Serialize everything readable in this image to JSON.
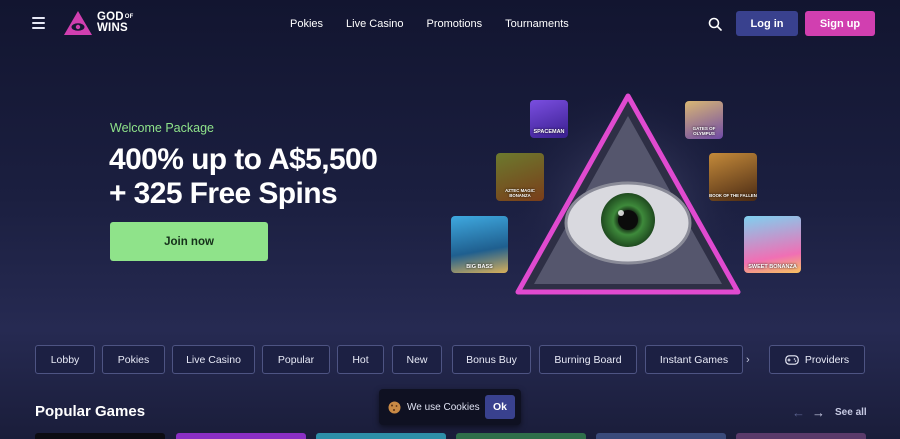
{
  "brand": {
    "logo_text_line1": "GOD",
    "logo_text_of": "OF",
    "logo_text_line2": "WINS",
    "accent_pink": "#d13fb0",
    "accent_green": "#8fe38a",
    "login_blue": "#39418e"
  },
  "header": {
    "nav": [
      "Pokies",
      "Live Casino",
      "Promotions",
      "Tournaments"
    ],
    "login_label": "Log in",
    "signup_label": "Sign up"
  },
  "hero": {
    "eyebrow": "Welcome Package",
    "headline_line1": "400% up to A$5,500",
    "headline_line2": "+ 325 Free Spins",
    "cta_label": "Join now",
    "games": [
      "SPACEMAN",
      "GATES OF OLYMPUS",
      "AZTEC MAGIC BONANZA",
      "BOOK OF THE FALLEN",
      "BIG BASS",
      "SWEET BONANZA"
    ]
  },
  "categories": [
    "Lobby",
    "Pokies",
    "Live Casino",
    "Popular",
    "Hot",
    "New",
    "Bonus Buy",
    "Burning Board",
    "Instant Games"
  ],
  "providers_label": "Providers",
  "popular": {
    "title": "Popular Games",
    "see_all": "See all"
  },
  "cookie": {
    "text": "We use Cookies",
    "ok_label": "Ok"
  }
}
